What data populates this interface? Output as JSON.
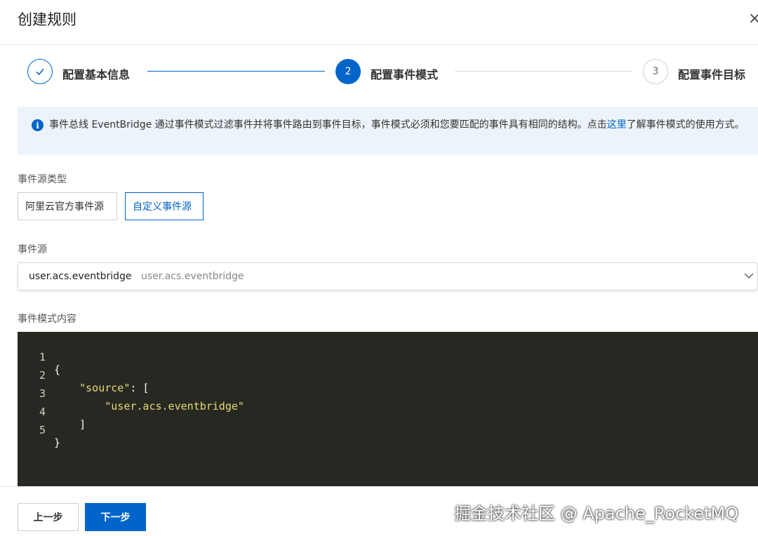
{
  "header": {
    "title": "创建规则",
    "close_symbol": "×"
  },
  "steps": [
    {
      "number": "",
      "label": "配置基本信息",
      "state": "done"
    },
    {
      "number": "2",
      "label": "配置事件模式",
      "state": "active"
    },
    {
      "number": "3",
      "label": "配置事件目标",
      "state": "pending"
    }
  ],
  "alert": {
    "icon": "info-icon",
    "text_before": "事件总线 EventBridge 通过事件模式过滤事件并将事件路由到事件目标，事件模式必须和您要匹配的事件具有相同的结构。点击",
    "link": "这里",
    "text_after": "了解事件模式的使用方式。"
  },
  "source_type": {
    "label": "事件源类型",
    "options": [
      "阿里云官方事件源",
      "自定义事件源"
    ],
    "selected": "自定义事件源"
  },
  "event_source": {
    "label": "事件源",
    "value": "user.acs.eventbridge",
    "sub_value": "user.acs.eventbridge"
  },
  "pattern": {
    "label": "事件模式内容",
    "lines": [
      {
        "n": "1",
        "text": "{"
      },
      {
        "n": "2",
        "text": "    \"source\": ["
      },
      {
        "n": "3",
        "text": "        \"user.acs.eventbridge\""
      },
      {
        "n": "4",
        "text": "    ]"
      },
      {
        "n": "5",
        "text": "}"
      }
    ]
  },
  "footer": {
    "prev_label": "上一步",
    "next_label": "下一步",
    "watermark": "掘金技术社区 @ Apache_RocketMQ"
  },
  "colors": {
    "primary": "#0064c8",
    "alert_bg": "#edf3fa",
    "editor_bg": "#272822",
    "string": "#e6db74"
  }
}
